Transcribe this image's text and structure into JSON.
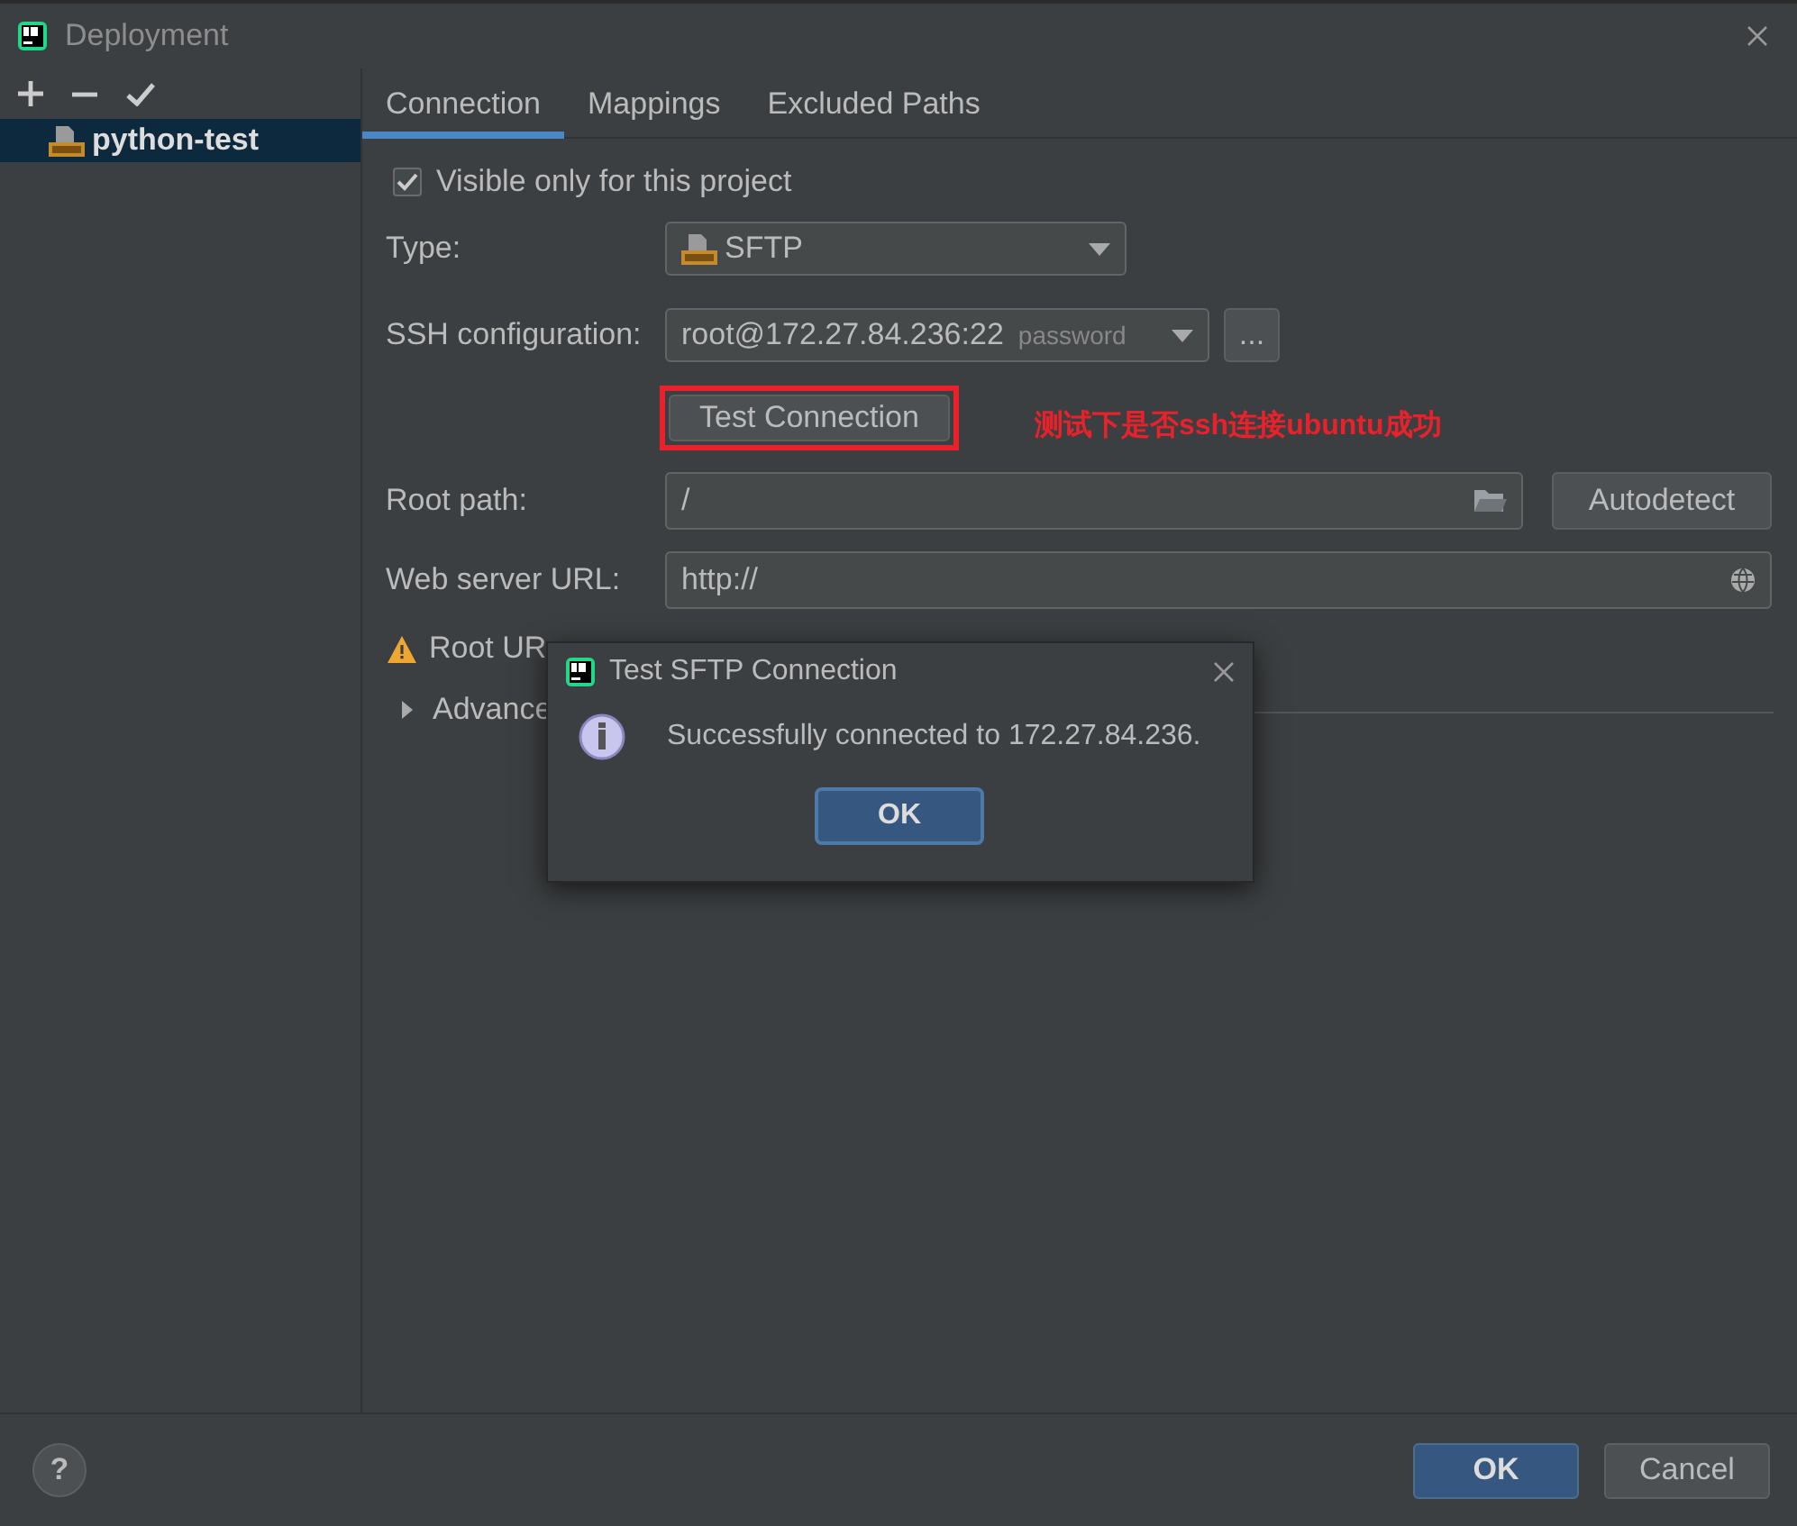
{
  "window": {
    "title": "Deployment"
  },
  "sidebar": {
    "items": [
      {
        "label": "python-test",
        "selected": true
      }
    ]
  },
  "tabs": [
    {
      "label": "Connection",
      "selected": true
    },
    {
      "label": "Mappings",
      "selected": false
    },
    {
      "label": "Excluded Paths",
      "selected": false
    }
  ],
  "visible_only_checkbox": {
    "label": "Visible only for this project",
    "checked": true
  },
  "type": {
    "label": "Type:",
    "value": "SFTP"
  },
  "ssh_configuration": {
    "label": "SSH configuration:",
    "value": "root@172.27.84.236:22",
    "hint": "password",
    "more_button": "..."
  },
  "test_button": "Test Connection",
  "annotation": "测试下是否ssh连接ubuntu成功",
  "root_path": {
    "label": "Root path:",
    "value": "/",
    "button": "Autodetect"
  },
  "web_server_url": {
    "label": "Web server URL:",
    "value": "http://"
  },
  "warning": "Root UR",
  "advanced": {
    "label": "Advance",
    "expanded": false
  },
  "message_dialog": {
    "title": "Test SFTP Connection",
    "message": "Successfully connected to 172.27.84.236.",
    "button": "OK"
  },
  "help": "?",
  "footer_buttons": [
    {
      "label": "OK",
      "kind": "primary"
    },
    {
      "label": "Cancel",
      "kind": "secondary"
    }
  ]
}
